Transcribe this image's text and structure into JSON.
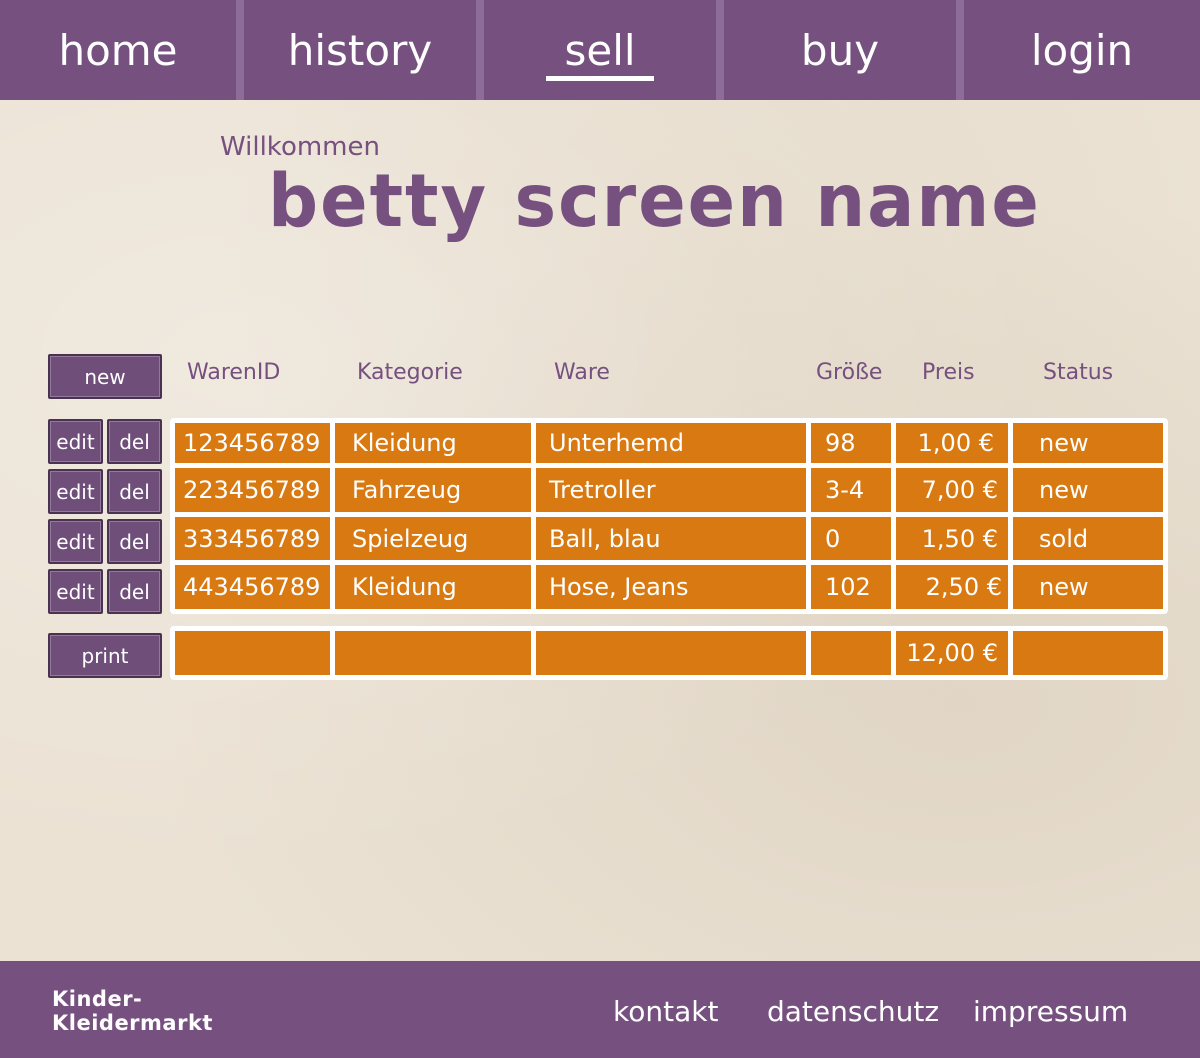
{
  "nav": {
    "items": [
      {
        "label": "home"
      },
      {
        "label": "history"
      },
      {
        "label": "sell"
      },
      {
        "label": "buy"
      },
      {
        "label": "login"
      }
    ],
    "active": "sell"
  },
  "header": {
    "welcome": "Willkommen",
    "username": "betty screen name"
  },
  "buttons": {
    "new": "new",
    "edit": "edit",
    "del": "del",
    "print": "print"
  },
  "table": {
    "columns": [
      "WarenID",
      "Kategorie",
      "Ware",
      "Größe",
      "Preis",
      "Status"
    ],
    "rows": [
      {
        "id": "123456789",
        "kategorie": "Kleidung",
        "ware": "Unterhemd",
        "groesse": "98",
        "preis": "1,00 €",
        "status": "new"
      },
      {
        "id": "223456789",
        "kategorie": "Fahrzeug",
        "ware": "Tretroller",
        "groesse": "3-4",
        "preis": "7,00 €",
        "status": "new"
      },
      {
        "id": "333456789",
        "kategorie": "Spielzeug",
        "ware": "Ball, blau",
        "groesse": "0",
        "preis": "1,50 €",
        "status": "sold"
      },
      {
        "id": "443456789",
        "kategorie": "Kleidung",
        "ware": "Hose, Jeans",
        "groesse": "102",
        "preis": "2,50 €",
        "status": "new"
      }
    ],
    "total": "12,00 €"
  },
  "footer": {
    "logo_line1": "Kinder-",
    "logo_line2": "Kleidermarkt",
    "links": [
      "kontakt",
      "datenschutz",
      "impressum"
    ]
  },
  "colors": {
    "purple": "#76507f",
    "orange": "#d87911",
    "paper": "#ebe2d4"
  }
}
